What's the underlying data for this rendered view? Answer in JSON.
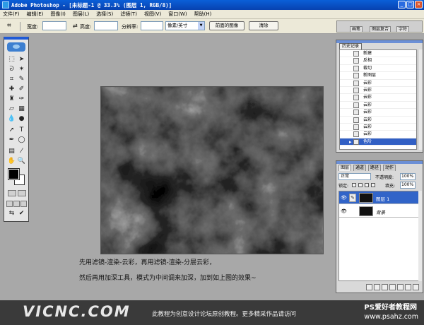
{
  "titlebar": {
    "title": "Adobe Photoshop - [未标题-1 @ 33.3% (图层 1, RGB/8)]"
  },
  "menu": [
    "文件(F)",
    "编辑(E)",
    "图像(I)",
    "图层(L)",
    "选择(S)",
    "滤镜(T)",
    "视图(V)",
    "窗口(W)",
    "帮助(H)"
  ],
  "options": {
    "width_label": "宽度:",
    "height_label": "高度:",
    "resolution_label": "分辨率:",
    "unit_select": "像素/英寸",
    "front_image_button": "前面的图像",
    "clear_button": "清除"
  },
  "palette_well": [
    "画笔",
    "图层复合",
    "字符"
  ],
  "history": {
    "tab": "历史记录",
    "items": [
      {
        "label": "新建",
        "selected": false
      },
      {
        "label": "反相",
        "selected": false
      },
      {
        "label": "裁切",
        "selected": false
      },
      {
        "label": "新图层",
        "selected": false
      },
      {
        "label": "云彩",
        "selected": false
      },
      {
        "label": "云彩",
        "selected": false
      },
      {
        "label": "云彩",
        "selected": false
      },
      {
        "label": "云彩",
        "selected": false
      },
      {
        "label": "云彩",
        "selected": false
      },
      {
        "label": "云彩",
        "selected": false
      },
      {
        "label": "云彩",
        "selected": false
      },
      {
        "label": "云彩",
        "selected": false
      },
      {
        "label": "色阶",
        "selected": true
      }
    ]
  },
  "layers": {
    "tabs": [
      "图层",
      "通道",
      "路径",
      "动作"
    ],
    "blend_mode": "正常",
    "opacity_label": "不透明度:",
    "opacity_value": "100%",
    "lock_label": "锁定:",
    "fill_label": "填充:",
    "fill_value": "100%",
    "items": [
      {
        "name": "图层 1",
        "selected": true
      },
      {
        "name": "背景",
        "selected": false
      }
    ]
  },
  "caption": {
    "line1": "先用滤镜-渲染-云彩，再用滤镜-渲染-分层云彩，",
    "line2": "然后再用加深工具，模式为中间调来加深，加到如上图的效果~"
  },
  "footer": {
    "logo": "VICNC.COM",
    "note": "此教程为创意设计论坛原创教程。更多精采作品请访问",
    "site_name": "PS爱好者教程网",
    "site_url": "www.psahz.com"
  }
}
